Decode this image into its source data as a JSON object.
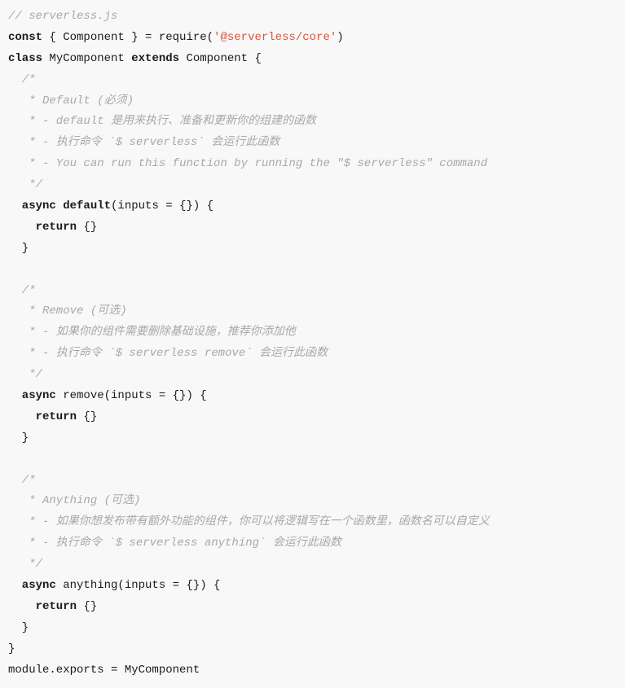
{
  "code": {
    "l01": "// serverless.js",
    "l02a": "const",
    "l02b": " { Component } = require(",
    "l02c": "'@serverless/core'",
    "l02d": ")",
    "l03a": "class",
    "l03b": " MyComponent ",
    "l03c": "extends",
    "l03d": " Component {",
    "l04": "  /*",
    "l05": "   * Default (必须)",
    "l06": "   * - default 是用来执行、准备和更新你的组建的函数",
    "l07": "   * - 执行命令 `$ serverless` 会运行此函数",
    "l08": "   * - You can run this function by running the \"$ serverless\" command",
    "l09": "   */",
    "l10a": "  async default",
    "l10b": "(inputs = {}) {",
    "l11a": "    return",
    "l11b": " {}",
    "l12": "  }",
    "l13": "",
    "l14": "  /*",
    "l15": "   * Remove (可选)",
    "l16": "   * - 如果你的组件需要删除基础设施，推荐你添加他",
    "l17": "   * - 执行命令 `$ serverless remove` 会运行此函数",
    "l18": "   */",
    "l19a": "  async",
    "l19b": " remove(inputs = {}) {",
    "l20a": "    return",
    "l20b": " {}",
    "l21": "  }",
    "l22": "",
    "l23": "  /*",
    "l24": "   * Anything (可选)",
    "l25": "   * - 如果你想发布带有额外功能的组件，你可以将逻辑写在一个函数里，函数名可以自定义",
    "l26": "   * - 执行命令 `$ serverless anything` 会运行此函数",
    "l27": "   */",
    "l28a": "  async",
    "l28b": " anything(inputs = {}) {",
    "l29a": "    return",
    "l29b": " {}",
    "l30": "  }",
    "l31": "}",
    "l32": "module.exports = MyComponent"
  }
}
